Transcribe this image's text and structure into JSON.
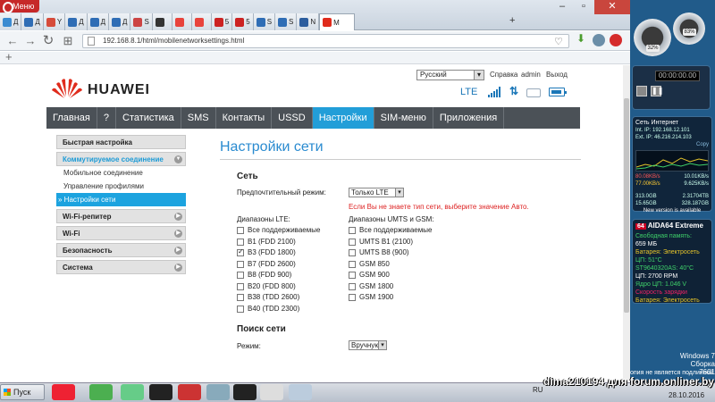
{
  "browser": {
    "menu_label": "Меню",
    "tabs": [
      {
        "favicon": "icon-pin",
        "color": "#3b8bd1",
        "label": "Д"
      },
      {
        "favicon": "icon-s",
        "color": "#2f6db5",
        "label": "Д"
      },
      {
        "favicon": "icon-yandex-s",
        "color": "#d64b3a",
        "label": "Y"
      },
      {
        "favicon": "icon-s",
        "color": "#2f6db5",
        "label": "Д"
      },
      {
        "favicon": "icon-s",
        "color": "#2f6db5",
        "label": "Д"
      },
      {
        "favicon": "icon-s",
        "color": "#2f6db5",
        "label": "Д"
      },
      {
        "favicon": "icon-s",
        "color": "#c44",
        "label": "S"
      },
      {
        "favicon": "icon-h",
        "color": "#333",
        "label": ""
      },
      {
        "favicon": "icon-info",
        "color": "#e8433c",
        "label": ""
      },
      {
        "favicon": "icon-info",
        "color": "#e8433c",
        "label": ""
      },
      {
        "favicon": "icon-sc",
        "color": "#c22",
        "label": "5"
      },
      {
        "favicon": "icon-sc",
        "color": "#c22",
        "label": "5"
      },
      {
        "favicon": "icon-s",
        "color": "#2f6db5",
        "label": "S"
      },
      {
        "favicon": "icon-s",
        "color": "#2f6db5",
        "label": "S"
      },
      {
        "favicon": "icon-n",
        "color": "#2c5d9e",
        "label": "N"
      },
      {
        "favicon": "icon-huawei",
        "color": "#e02b1c",
        "label": "M",
        "active": true
      }
    ],
    "url": "192.168.8.1/html/mobilenetworksettings.html",
    "new_tab": "+"
  },
  "router": {
    "logo": "HUAWEI",
    "language": "Русский",
    "links": [
      "Справка",
      "admin",
      "Выход"
    ],
    "network_type": "LTE",
    "nav": [
      {
        "label": "Главная"
      },
      {
        "label": "?"
      },
      {
        "label": "Статистика"
      },
      {
        "label": "SMS"
      },
      {
        "label": "Контакты"
      },
      {
        "label": "USSD"
      },
      {
        "label": "Настройки",
        "active": true
      },
      {
        "label": "SIM-меню"
      },
      {
        "label": "Приложения"
      }
    ],
    "sidebar": {
      "quick": "Быстрая настройка",
      "dialup": "Коммутируемое соединение",
      "dialup_items": [
        "Мобильное соединение",
        "Управление профилями",
        "» Настройки сети"
      ],
      "wifi_repeater": "Wi-Fi-репитер",
      "wifi": "Wi-Fi",
      "security": "Безопасность",
      "system": "Система"
    },
    "page_title": "Настройки сети",
    "network": {
      "section_title": "Сеть",
      "preferred_mode_label": "Предпочтительный режим:",
      "preferred_mode_value": "Только LTE",
      "warning": "Если Вы не знаете тип сети, выберите значение Авто.",
      "lte_title": "Диапазоны LTE:",
      "lte_bands": [
        {
          "label": "Все поддерживаемые",
          "checked": false
        },
        {
          "label": "B1 (FDD 2100)",
          "checked": false
        },
        {
          "label": "B3 (FDD 1800)",
          "checked": true
        },
        {
          "label": "B7 (FDD 2600)",
          "checked": false
        },
        {
          "label": "B8 (FDD 900)",
          "checked": false
        },
        {
          "label": "B20 (FDD 800)",
          "checked": false
        },
        {
          "label": "B38 (TDD 2600)",
          "checked": false
        },
        {
          "label": "B40 (TDD 2300)",
          "checked": false
        }
      ],
      "umts_title": "Диапазоны UMTS и GSM:",
      "umts_bands": [
        {
          "label": "Все поддерживаемые",
          "checked": false
        },
        {
          "label": "UMTS B1 (2100)",
          "checked": false
        },
        {
          "label": "UMTS B8 (900)",
          "checked": false
        },
        {
          "label": "GSM 850",
          "checked": false
        },
        {
          "label": "GSM 900",
          "checked": false
        },
        {
          "label": "GSM 1800",
          "checked": false
        },
        {
          "label": "GSM 1900",
          "checked": false
        }
      ]
    },
    "search": {
      "section_title": "Поиск сети",
      "mode_label": "Режим:",
      "mode_value": "Вручную"
    }
  },
  "desktop": {
    "gauge_cpu": "32%",
    "gauge_mem": "83%",
    "timer": "00:00:00.00",
    "net_gadget": {
      "title": "Сеть Интернет",
      "int_ip": "Int. IP: 192.168.12.101",
      "ext_ip": "Ext. IP: 46.216.214.103",
      "copy": "Copy",
      "down": "80.08KB/s",
      "up": "77.00KB/s",
      "total_down": "2.31704TB",
      "total_up": "328.187GB",
      "day_down": "313.0GB",
      "day_up": "15.65GB",
      "version": "New version is available",
      "tooltip1": "10.01KB/s",
      "tooltip2": "9.625KB/s"
    },
    "aida": {
      "title": "AIDA64 Extreme",
      "lines": [
        "Свободная память:",
        "659 МБ",
        "Батарея: Электросеть",
        "ЦП: 51°C",
        "ST9640320AS: 40°C",
        "ЦП: 2700 RPM",
        "Ядро ЦП: 1.046 V",
        "Скорость зарядки",
        "Батарея: Электросеть"
      ]
    },
    "win_label": "Windows 7",
    "build": "Сборка 7601",
    "license": "опия не является подлинной",
    "watermark": "dima210194 для forum.onliner.by",
    "start": "Пуск",
    "lang": "RU",
    "date": "28.10.2016"
  }
}
